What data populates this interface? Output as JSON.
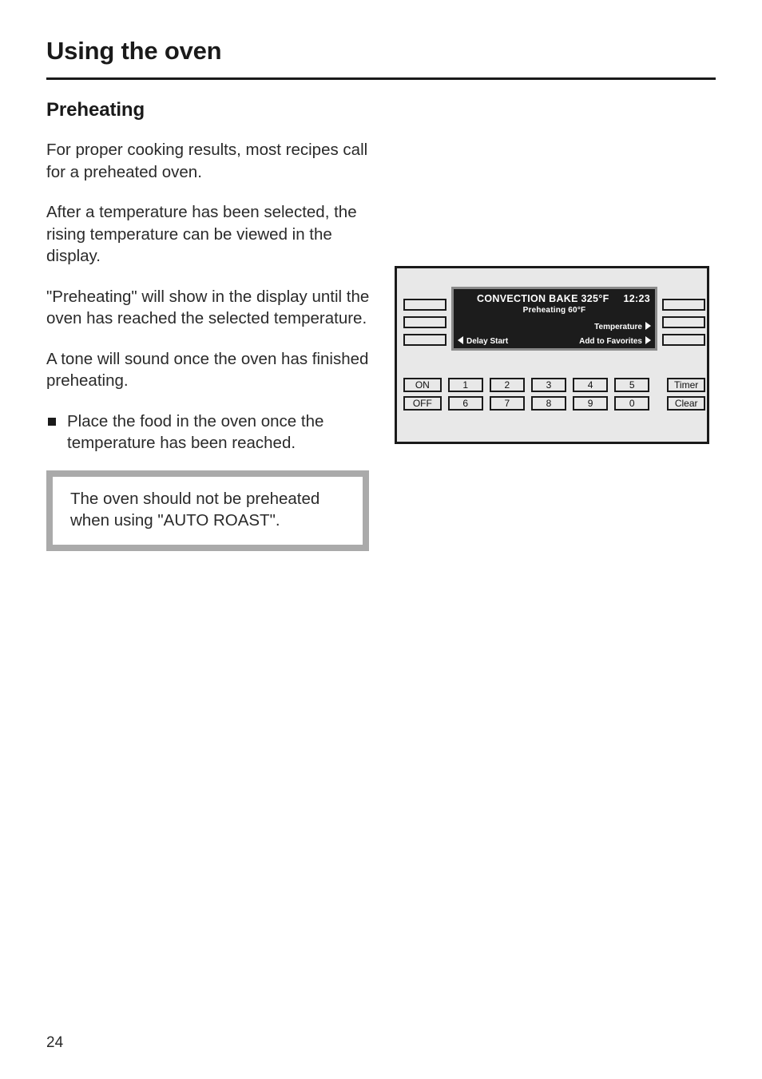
{
  "document": {
    "chapter_title": "Using the oven",
    "page_number": "24"
  },
  "section": {
    "title": "Preheating",
    "paragraphs": [
      "For proper cooking results, most recipes call for a preheated oven.",
      "After a temperature has been selected, the rising temperature can be viewed in the display.",
      "\"Preheating\" will show in the display until the oven has reached the selected temperature.",
      "A tone will sound once the oven has finished preheating."
    ],
    "bullets": [
      "Place the food in the oven once the temperature has been reached."
    ],
    "note": "The oven should not be preheated when using \"AUTO ROAST\"."
  },
  "control_panel": {
    "display": {
      "mode": "CONVECTION BAKE 325°F",
      "clock": "12:23",
      "status": "Preheating 60°F",
      "right_option_1": "Temperature",
      "right_option_2": "Add to Favorites",
      "left_option_1": "Delay Start"
    },
    "left_blank_keys": [
      "",
      "",
      ""
    ],
    "right_blank_keys": [
      "",
      "",
      ""
    ],
    "power_keys": [
      "ON",
      "OFF"
    ],
    "number_keys_row1": [
      "1",
      "2",
      "3",
      "4",
      "5"
    ],
    "number_keys_row2": [
      "6",
      "7",
      "8",
      "9",
      "0"
    ],
    "function_keys": [
      "Timer",
      "Clear"
    ]
  },
  "colors": {
    "display_background": "#1c1c1c",
    "display_text": "#ffffff",
    "panel_background": "#e8e8e8",
    "panel_border": "#1a1a1a",
    "note_border": "#aaaaaa",
    "rule": "#1a1a1a"
  }
}
